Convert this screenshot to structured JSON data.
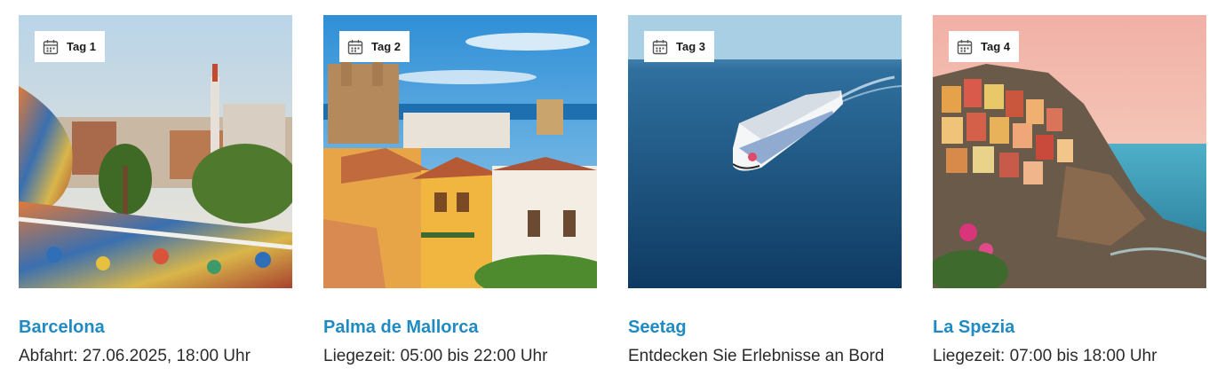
{
  "itinerary": {
    "days": [
      {
        "tag": "Tag 1",
        "title": "Barcelona",
        "detail": "Abfahrt: 27.06.2025, 18:00 Uhr",
        "image": "barcelona-park-guell-photo"
      },
      {
        "tag": "Tag 2",
        "title": "Palma de Mallorca",
        "detail": "Liegezeit: 05:00 bis 22:00 Uhr",
        "image": "palma-old-town-photo"
      },
      {
        "tag": "Tag 3",
        "title": "Seetag",
        "detail": "Entdecken Sie Erlebnisse an Bord",
        "image": "cruise-ship-at-sea-photo"
      },
      {
        "tag": "Tag 4",
        "title": "La Spezia",
        "detail": "Liegezeit: 07:00 bis 18:00 Uhr",
        "image": "cinque-terre-village-photo"
      }
    ],
    "icons": {
      "badge": "calendar-icon"
    },
    "colors": {
      "title": "#1f8bc2",
      "text": "#2b2b2b",
      "badge_bg": "#ffffff"
    }
  }
}
